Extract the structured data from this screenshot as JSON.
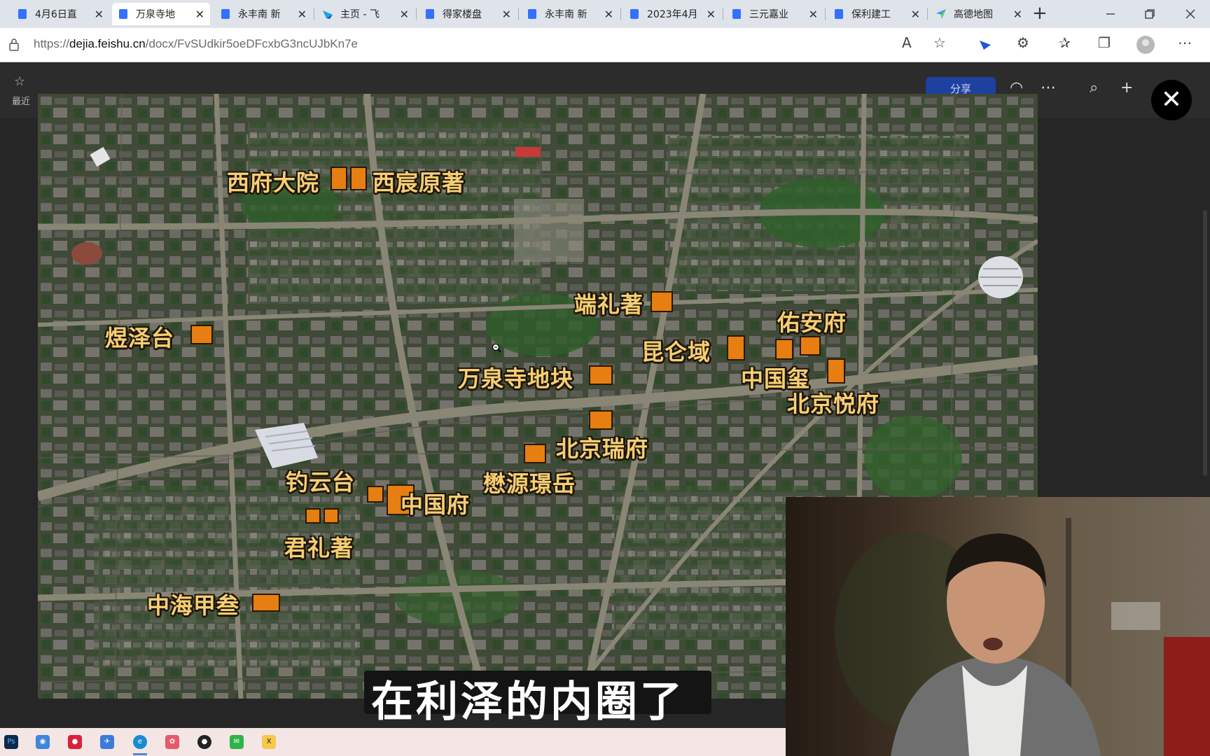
{
  "browser": {
    "tabs": [
      {
        "label": "4月6日直",
        "icon": "document-icon",
        "color": "#3370ff",
        "active": false
      },
      {
        "label": "万泉寺地",
        "icon": "document-icon",
        "color": "#3370ff",
        "active": true
      },
      {
        "label": "永丰南 新",
        "icon": "document-icon",
        "color": "#3370ff",
        "active": false
      },
      {
        "label": "主页 - 飞",
        "icon": "feishu-icon",
        "color": "#1aa3e8",
        "active": false
      },
      {
        "label": "得家楼盘",
        "icon": "document-icon",
        "color": "#3370ff",
        "active": false
      },
      {
        "label": "永丰南 新",
        "icon": "document-icon",
        "color": "#3370ff",
        "active": false
      },
      {
        "label": "2023年4月",
        "icon": "document-icon",
        "color": "#3370ff",
        "active": false
      },
      {
        "label": "三元嘉业",
        "icon": "document-icon",
        "color": "#3370ff",
        "active": false
      },
      {
        "label": "保利建工",
        "icon": "document-icon",
        "color": "#3370ff",
        "active": false
      },
      {
        "label": "高德地图",
        "icon": "amap-icon",
        "color": "#2da1f8",
        "active": false
      }
    ],
    "close_symbol": "✕",
    "new_tab_symbol": "+",
    "url_scheme": "https://",
    "url_host": "dejia.feishu.cn",
    "url_path": "/docx/FvSUdkir5oeDFcxbG3ncUJbKn7e"
  },
  "feishu": {
    "recent_label": "最近",
    "share_label": "分享"
  },
  "viewer": {
    "close_symbol": "✕",
    "map_labels": [
      {
        "text": "西府大院"
      },
      {
        "text": "西宸原著"
      },
      {
        "text": "端礼著"
      },
      {
        "text": "佑安府"
      },
      {
        "text": "煜泽台"
      },
      {
        "text": "昆仑域"
      },
      {
        "text": "万泉寺地块"
      },
      {
        "text": "中国玺"
      },
      {
        "text": "北京悦府"
      },
      {
        "text": "北京瑞府"
      },
      {
        "text": "钓云台"
      },
      {
        "text": "懋源璟岳"
      },
      {
        "text": "中国府"
      },
      {
        "text": "君礼著"
      },
      {
        "text": "中海甲叁"
      }
    ]
  },
  "video": {
    "subtitle": "在利泽的内圈了"
  },
  "colors": {
    "plot_marker": "#e67e11",
    "label_text": "#f6ce73",
    "feishu_blue": "#3370ff"
  }
}
